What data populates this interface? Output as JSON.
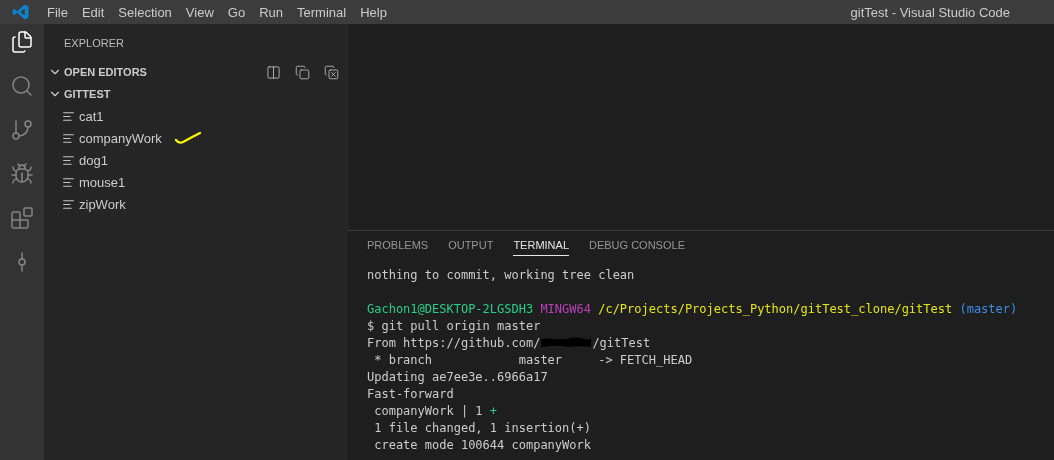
{
  "window": {
    "title": "gitTest - Visual Studio Code"
  },
  "menu": [
    "File",
    "Edit",
    "Selection",
    "View",
    "Go",
    "Run",
    "Terminal",
    "Help"
  ],
  "activity_bar": [
    {
      "kind": "explorer",
      "selected": true
    },
    {
      "kind": "search",
      "selected": false
    },
    {
      "kind": "source-control",
      "selected": false
    },
    {
      "kind": "run-debug",
      "selected": false
    },
    {
      "kind": "extensions",
      "selected": false
    },
    {
      "kind": "git-graph",
      "selected": false
    }
  ],
  "sidebar": {
    "title": "EXPLORER",
    "sections": [
      {
        "label": "OPEN EDITORS",
        "expanded": true,
        "actions": true
      },
      {
        "label": "GITTEST",
        "expanded": true,
        "actions": false,
        "files": [
          {
            "name": "cat1",
            "annotated": false
          },
          {
            "name": "companyWork",
            "annotated": true
          },
          {
            "name": "dog1",
            "annotated": false
          },
          {
            "name": "mouse1",
            "annotated": false
          },
          {
            "name": "zipWork",
            "annotated": false
          }
        ]
      }
    ]
  },
  "panel": {
    "tabs": [
      {
        "label": "PROBLEMS",
        "selected": false
      },
      {
        "label": "OUTPUT",
        "selected": false
      },
      {
        "label": "TERMINAL",
        "selected": true
      },
      {
        "label": "DEBUG CONSOLE",
        "selected": false
      }
    ],
    "terminal": [
      {
        "kind": "text",
        "segments": [
          {
            "kind": "plain",
            "text": "nothing to commit, working tree clean"
          }
        ]
      },
      {
        "kind": "spaced",
        "segments": [
          {
            "kind": "user",
            "text": "Gachon1@DESKTOP-2LGSDH3"
          },
          {
            "kind": "host",
            "text": "MINGW64"
          },
          {
            "kind": "path",
            "text": "/c/Projects/Projects_Python/gitTest_clone/gitTest"
          },
          {
            "kind": "branch",
            "text": "(master)"
          }
        ]
      },
      {
        "kind": "text",
        "segments": [
          {
            "kind": "plain",
            "text": "$ git pull origin master"
          }
        ]
      },
      {
        "kind": "text",
        "segments": [
          {
            "kind": "plain",
            "text": "From https://github.com/"
          },
          {
            "kind": "redacted"
          },
          {
            "kind": "plain",
            "text": "/gitTest"
          }
        ]
      },
      {
        "kind": "text",
        "segments": [
          {
            "kind": "plain",
            "text": " * branch            master     -> FETCH_HEAD"
          }
        ]
      },
      {
        "kind": "text",
        "segments": [
          {
            "kind": "plain",
            "text": "Updating ae7ee3e..6966a17"
          }
        ]
      },
      {
        "kind": "text",
        "segments": [
          {
            "kind": "plain",
            "text": "Fast-forward"
          }
        ]
      },
      {
        "kind": "text",
        "segments": [
          {
            "kind": "plain",
            "text": " companyWork | 1 "
          },
          {
            "kind": "added",
            "text": "+"
          }
        ]
      },
      {
        "kind": "text",
        "segments": [
          {
            "kind": "plain",
            "text": " 1 file changed, 1 insertion(+)"
          }
        ]
      },
      {
        "kind": "text",
        "segments": [
          {
            "kind": "plain",
            "text": " create mode 100644 companyWork"
          }
        ]
      }
    ]
  }
}
